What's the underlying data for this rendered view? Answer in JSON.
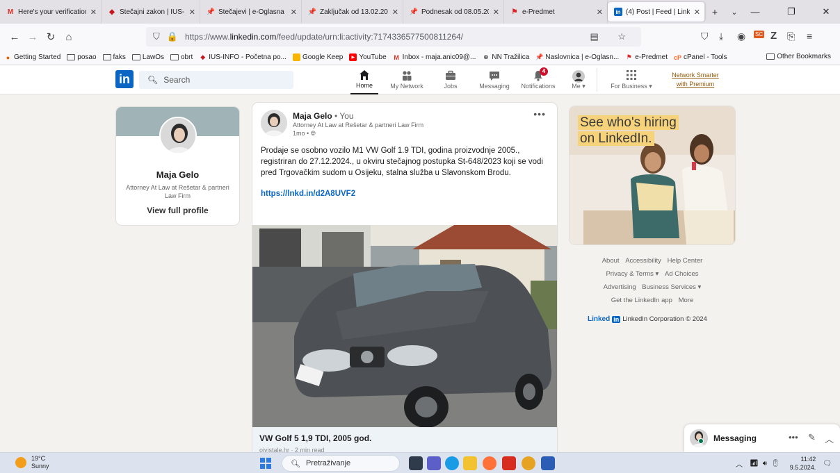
{
  "browser": {
    "tabs": [
      {
        "title": "Here's your verification",
        "favicon": "gmail-icon",
        "color": "#d93025"
      },
      {
        "title": "Stečajni zakon | IUS-INI",
        "favicon": "ius-info-icon",
        "color": "#c4161c"
      },
      {
        "title": "Stečajevi | e-Oglasna pl",
        "favicon": "pin-icon",
        "color": "#d4213d"
      },
      {
        "title": "Zaključak od 13.02.2024",
        "favicon": "pin-icon",
        "color": "#d4213d"
      },
      {
        "title": "Podnesak od 08.05.2024",
        "favicon": "pin-icon",
        "color": "#d4213d"
      },
      {
        "title": "e-Predmet",
        "favicon": "flag-icon",
        "color": "#e02020"
      },
      {
        "title": "(4) Post | Feed | LinkedIn",
        "favicon": "linkedin-icon",
        "color": "#0a66c2"
      }
    ],
    "url_prefix": "https://www.",
    "url_domain": "linkedin.com",
    "url_rest": "/feed/update/urn:li:activity:7174336577500811264/",
    "bookmarks": [
      {
        "label": "Getting Started",
        "icon": "firefox-icon"
      },
      {
        "label": "posao",
        "icon": "folder-icon"
      },
      {
        "label": "faks",
        "icon": "folder-icon"
      },
      {
        "label": "LawOs",
        "icon": "folder-icon"
      },
      {
        "label": "obrt",
        "icon": "folder-icon"
      },
      {
        "label": "IUS-INFO - Početna po...",
        "icon": "ius-info-icon"
      },
      {
        "label": "Google Keep",
        "icon": "keep-icon"
      },
      {
        "label": "YouTube",
        "icon": "youtube-icon"
      },
      {
        "label": "Inbox - maja.anic09@...",
        "icon": "gmail-icon"
      },
      {
        "label": "NN Tražilica",
        "icon": "globe-icon"
      },
      {
        "label": "Naslovnica | e-Oglasn...",
        "icon": "pin-icon"
      },
      {
        "label": "e-Predmet",
        "icon": "flag-icon"
      },
      {
        "label": "cPanel - Tools",
        "icon": "cpanel-icon"
      }
    ],
    "other_bookmarks": "Other Bookmarks"
  },
  "linkedin": {
    "logo": "in",
    "search_placeholder": "Search",
    "nav": [
      {
        "label": "Home",
        "icon": "home-icon",
        "glyph": "🏠",
        "active": true
      },
      {
        "label": "My Network",
        "icon": "network-icon",
        "glyph": "👥",
        "active": false
      },
      {
        "label": "Jobs",
        "icon": "briefcase-icon",
        "glyph": "💼",
        "active": false
      },
      {
        "label": "Messaging",
        "icon": "chat-icon",
        "glyph": "💬",
        "active": false
      },
      {
        "label": "Notifications",
        "icon": "bell-icon",
        "glyph": "🔔",
        "active": false,
        "badge": "4"
      },
      {
        "label": "Me ▾",
        "icon": "avatar-icon",
        "glyph": "",
        "active": false
      },
      {
        "label": "For Business ▾",
        "icon": "grid-icon",
        "glyph": "⋮⋮⋮",
        "active": false
      }
    ],
    "premium_line1": "Network Smarter",
    "premium_line2": "with Premium"
  },
  "profile": {
    "name": "Maja Gelo",
    "title": "Attorney At Law at Rešetar & partneri Law Firm",
    "view_link": "View full profile"
  },
  "post": {
    "author": "Maja Gelo",
    "degree": " • You",
    "headline": "Attorney At Law at Rešetar & partneri Law Firm",
    "time": "1mo •",
    "body": "Prodaje se osobno vozilo M1 VW Golf 1.9 TDI, godina proizvodnje 2005., registriran do 27.12.2024., u okviru stečajnog postupka St-648/2023 koji se vodi pred Trgovačkim sudom u Osijeku, stalna služba u Slavonskom Brodu.",
    "link": "https://lnkd.in/d2A8UVF2",
    "caption": "VW Golf 5 1,9 TDI, 2005 god.",
    "subcaption": "ojvistale.hr · 2 min read",
    "plate": "SB 689-HL"
  },
  "ad": {
    "line1": "See who's hiring",
    "line2": "on LinkedIn."
  },
  "footer": {
    "row1": [
      "About",
      "Accessibility",
      "Help Center"
    ],
    "row2": [
      "Privacy & Terms ▾",
      "Ad Choices"
    ],
    "row3": [
      "Advertising",
      "Business Services ▾"
    ],
    "row4": [
      "Get the LinkedIn app",
      "More"
    ],
    "brand_text": "Linked",
    "brand_box": "in",
    "copyright": "LinkedIn Corporation © 2024"
  },
  "messaging": {
    "label": "Messaging"
  },
  "taskbar": {
    "temp": "19°C",
    "condition": "Sunny",
    "search_placeholder": "Pretraživanje",
    "time": "11:42",
    "date": "9.5.2024."
  }
}
